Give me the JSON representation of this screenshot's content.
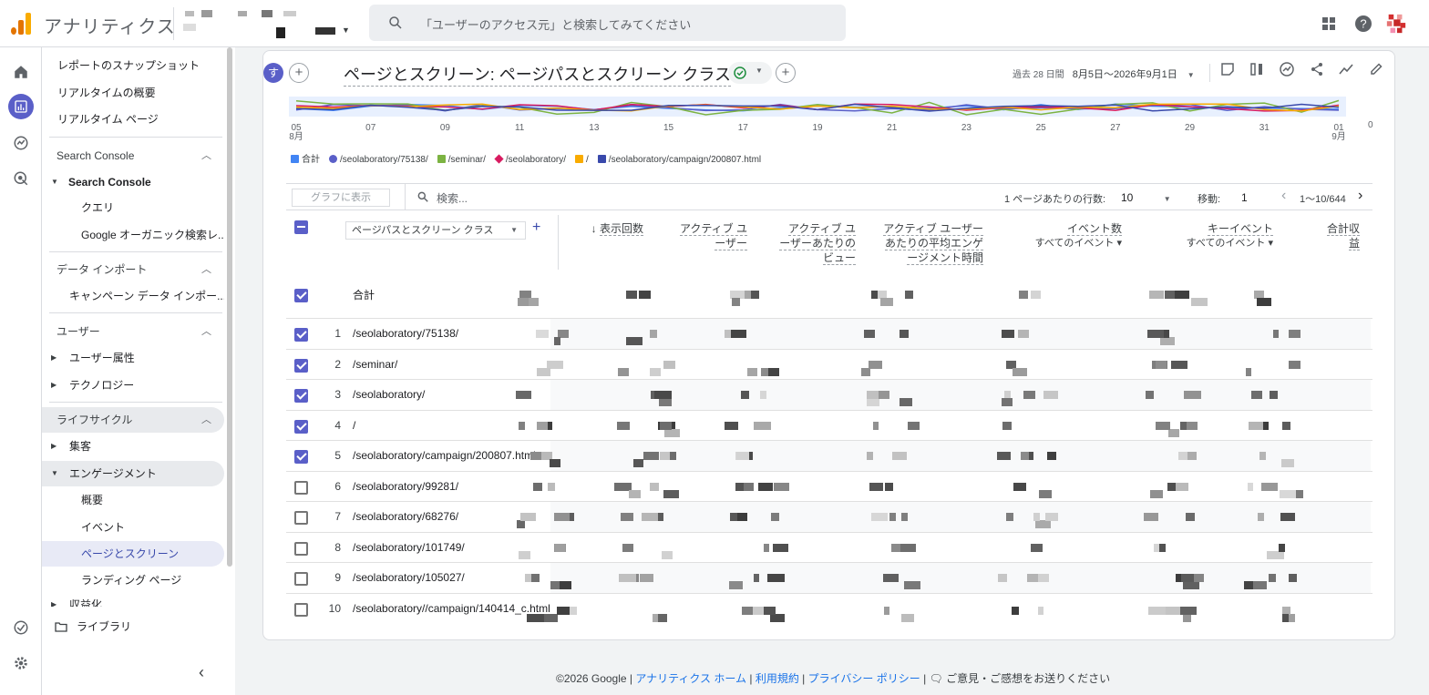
{
  "header": {
    "app_name": "アナリティクス",
    "search_placeholder": "「ユーザーのアクセス元」と検索してみてください"
  },
  "nav": {
    "items": [
      {
        "label": "レポートのスナップショット"
      },
      {
        "label": "リアルタイムの概要"
      },
      {
        "label": "リアルタイム ページ"
      }
    ],
    "sc_section": "Search Console",
    "sc_group": "Search Console",
    "sc_children": [
      "クエリ",
      "Google オーガニック検索レ..."
    ],
    "import_section": "データ インポート",
    "import_child": "キャンペーン データ インポー...",
    "user_section": "ユーザー",
    "user_children": [
      "ユーザー属性",
      "テクノロジー"
    ],
    "life_section": "ライフサイクル",
    "life_children": [
      "集客",
      "エンゲージメント"
    ],
    "engage_children": [
      "概要",
      "イベント",
      "ページとスクリーン",
      "ランディング ページ"
    ],
    "cut_item": "収益化",
    "library": "ライブラリ"
  },
  "report": {
    "avatar_letter": "す",
    "title": "ページとスクリーン: ページパスとスクリーン クラス",
    "date_prefix": "過去 28 日間",
    "date_range": "8月5日～2026年9月1日"
  },
  "chart_data": {
    "type": "line",
    "x_ticks": [
      "05",
      "07",
      "09",
      "11",
      "13",
      "15",
      "17",
      "19",
      "21",
      "23",
      "25",
      "27",
      "29",
      "31",
      "01"
    ],
    "x_month_labels": {
      "05": "8月",
      "01": "9月"
    },
    "y_right_label": "0",
    "legend": [
      {
        "name": "合計",
        "color": "#4285f4"
      },
      {
        "name": "/seolaboratory/75138/",
        "color": "#5a5fc8"
      },
      {
        "name": "/seminar/",
        "color": "#7cb342"
      },
      {
        "name": "/seolaboratory/",
        "color": "#d81b60"
      },
      {
        "name": "/",
        "color": "#f9ab00"
      },
      {
        "name": "/seolaboratory/campaign/200807.html",
        "color": "#3949ab"
      }
    ]
  },
  "table": {
    "graph_button": "グラフに表示",
    "search_placeholder": "検索...",
    "rows_per_page_label": "1 ページあたりの行数:",
    "rows_per_page": "10",
    "goto_label": "移動:",
    "goto_value": "1",
    "range": "1～10/644",
    "dimension": "ページパスとスクリーン クラス",
    "headers": [
      {
        "label": "表示回数",
        "sub": ""
      },
      {
        "label": "アクティブ ユーザー",
        "sub": ""
      },
      {
        "label": "アクティブ ユーザーあたりのビュー",
        "sub": ""
      },
      {
        "label": "アクティブ ユーザーあたりの平均エンゲージメント時間",
        "sub": ""
      },
      {
        "label": "イベント数",
        "sub": "すべてのイベント"
      },
      {
        "label": "キーイベント",
        "sub": "すべてのイベント"
      },
      {
        "label": "合計収益",
        "sub": ""
      }
    ],
    "total_label": "合計",
    "rows": [
      {
        "n": "1",
        "path": "/seolaboratory/75138/",
        "checked": true
      },
      {
        "n": "2",
        "path": "/seminar/",
        "checked": true
      },
      {
        "n": "3",
        "path": "/seolaboratory/",
        "checked": true
      },
      {
        "n": "4",
        "path": "/",
        "checked": true
      },
      {
        "n": "5",
        "path": "/seolaboratory/campaign/200807.html",
        "checked": true
      },
      {
        "n": "6",
        "path": "/seolaboratory/99281/",
        "checked": false
      },
      {
        "n": "7",
        "path": "/seolaboratory/68276/",
        "checked": false
      },
      {
        "n": "8",
        "path": "/seolaboratory/101749/",
        "checked": false
      },
      {
        "n": "9",
        "path": "/seolaboratory/105027/",
        "checked": false
      },
      {
        "n": "10",
        "path": "/seolaboratory//campaign/140414_c.html",
        "checked": false
      }
    ]
  },
  "footer": {
    "copyright": "©2026 Google |",
    "links": [
      "アナリティクス ホーム",
      "利用規約",
      "プライバシー ポリシー"
    ],
    "feedback": "ご意見・ご感想をお送りください"
  }
}
